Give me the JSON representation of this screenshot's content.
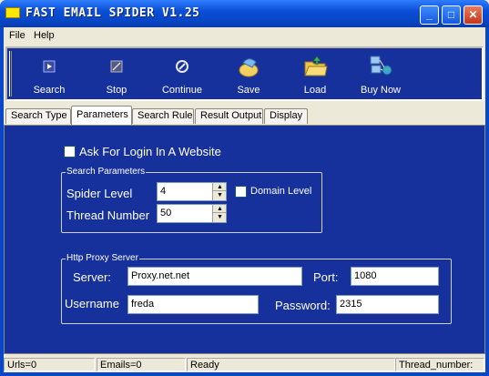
{
  "window": {
    "title": "FAST EMAIL SPIDER  V1.25"
  },
  "menu": {
    "items": [
      "File",
      "Help"
    ]
  },
  "toolbar": {
    "buttons": [
      {
        "label": "Search",
        "icon": "search-icon"
      },
      {
        "label": "Stop",
        "icon": "stop-icon"
      },
      {
        "label": "Continue",
        "icon": "continue-icon"
      },
      {
        "label": "Save",
        "icon": "save-icon"
      },
      {
        "label": "Load",
        "icon": "load-folder-icon"
      },
      {
        "label": "Buy Now",
        "icon": "buy-now-network-icon"
      }
    ]
  },
  "tabs": {
    "items": [
      "Search Type",
      "Parameters",
      "Search Rule",
      "Result Output",
      "Display"
    ],
    "active": "Parameters"
  },
  "parameters": {
    "ask_login_label": "Ask For Login In A Website",
    "ask_login_checked": false,
    "search_params": {
      "title": "Search Parameters",
      "spider_level_label": "Spider Level",
      "spider_level_value": "4",
      "domain_level_label": "Domain Level",
      "domain_level_checked": false,
      "thread_number_label": "Thread Number",
      "thread_number_value": "50"
    },
    "proxy": {
      "title": "Http Proxy Server",
      "server_label": "Server:",
      "server_value": "Proxy.net.net",
      "port_label": "Port:",
      "port_value": "1080",
      "username_label": "Username",
      "username_value": "freda",
      "password_label": "Password:",
      "password_value": "2315"
    }
  },
  "status": {
    "urls": "Urls=0",
    "emails": "Emails=0",
    "state": "Ready",
    "thread": "Thread_number:"
  },
  "colors": {
    "panel_bg": "#17319c",
    "title_bar": "#0a4fd6"
  }
}
